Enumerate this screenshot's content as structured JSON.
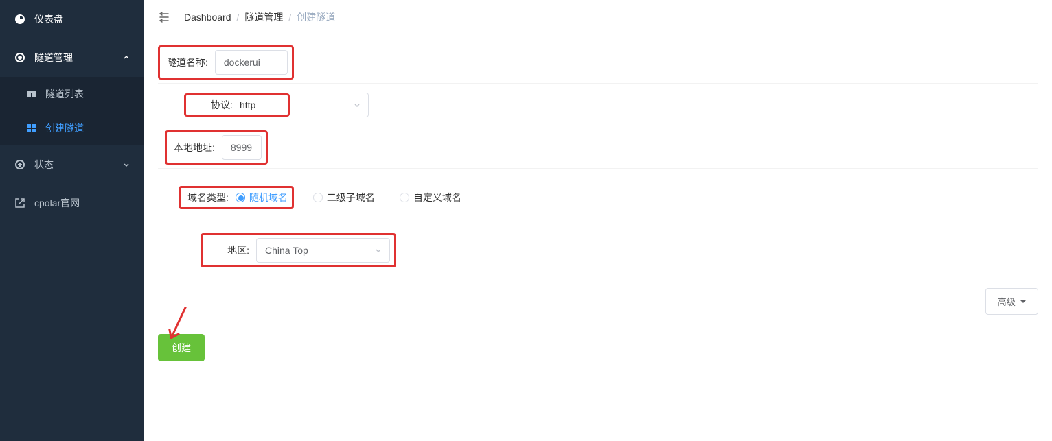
{
  "sidebar": {
    "items": [
      {
        "label": "仪表盘"
      },
      {
        "label": "隧道管理"
      },
      {
        "label": "状态"
      },
      {
        "label": "cpolar官网"
      }
    ],
    "tunnel_sub": [
      {
        "label": "隧道列表"
      },
      {
        "label": "创建隧道"
      }
    ]
  },
  "breadcrumb": {
    "a": "Dashboard",
    "b": "隧道管理",
    "c": "创建隧道"
  },
  "form": {
    "name_label": "隧道名称:",
    "name_value": "dockerui",
    "proto_label": "协议:",
    "proto_value": "http",
    "addr_label": "本地地址:",
    "addr_value": "8999",
    "domain_label": "域名类型:",
    "domain_options": [
      "随机域名",
      "二级子域名",
      "自定义域名"
    ],
    "region_label": "地区:",
    "region_value": "China Top",
    "advanced_label": "高级",
    "create_label": "创建"
  }
}
